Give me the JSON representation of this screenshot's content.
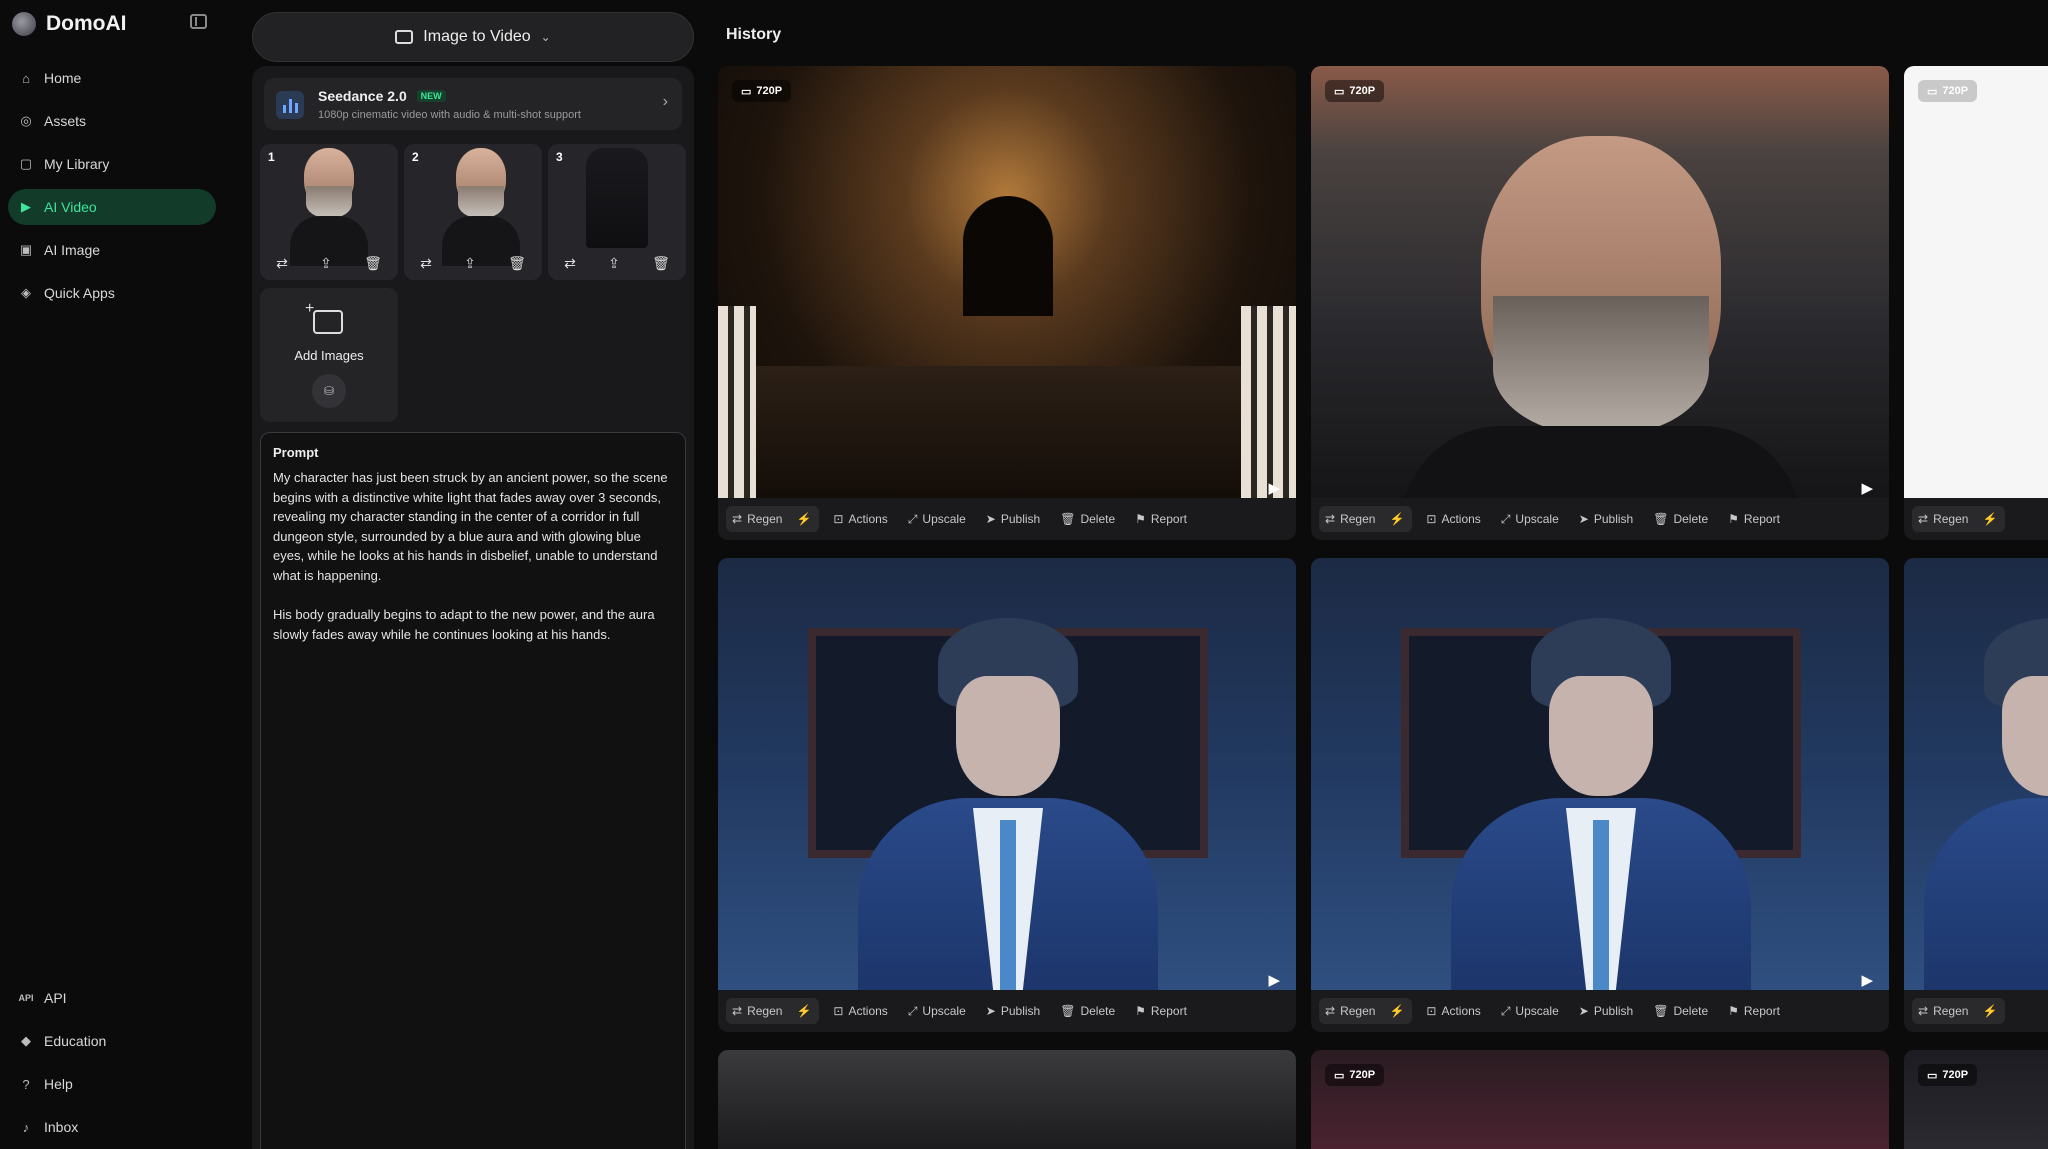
{
  "brand": {
    "name": "DomoAI"
  },
  "nav": {
    "main": [
      {
        "label": "Home",
        "icon": "home-icon",
        "glyph": "⌂"
      },
      {
        "label": "Assets",
        "icon": "assets-icon",
        "glyph": "◎"
      },
      {
        "label": "My Library",
        "icon": "library-icon",
        "glyph": "▢"
      },
      {
        "label": "AI Video",
        "icon": "video-icon",
        "glyph": "▶",
        "active": true
      },
      {
        "label": "AI Image",
        "icon": "image-icon",
        "glyph": "▣"
      },
      {
        "label": "Quick Apps",
        "icon": "apps-icon",
        "glyph": "◈"
      }
    ],
    "bottom": [
      {
        "label": "API",
        "icon": "api-icon",
        "glyph": "API"
      },
      {
        "label": "Education",
        "icon": "education-icon",
        "glyph": "◆"
      },
      {
        "label": "Help",
        "icon": "help-icon",
        "glyph": "?"
      },
      {
        "label": "Inbox",
        "icon": "bell-icon",
        "glyph": "♪"
      }
    ]
  },
  "generator": {
    "mode_label": "Image to Video",
    "model": {
      "name": "Seedance 2.0",
      "badge": "NEW",
      "description": "1080p cinematic video with audio & multi-shot support"
    },
    "references": [
      {
        "number": "1"
      },
      {
        "number": "2"
      },
      {
        "number": "3"
      }
    ],
    "add_images_label": "Add Images",
    "prompt": {
      "label": "Prompt",
      "text": "My character has just been struck by an ancient power, so the scene begins with a distinctive white light that fades away over 3 seconds, revealing my character standing in the center of a corridor in full dungeon style, surrounded by a blue aura and with glowing blue eyes, while he looks at his hands in disbelief, unable to understand what is happening.\n\nHis body gradually begins to adapt to the new power, and the aura slowly fades away while he continues looking at his hands."
    }
  },
  "history": {
    "title": "History",
    "resolution": "720P",
    "toolbar": {
      "regen": "Regen",
      "actions": "Actions",
      "upscale": "Upscale",
      "publish": "Publish",
      "delete": "Delete",
      "report": "Report"
    }
  },
  "colors": {
    "accent": "#3ee59a",
    "active_bg": "#123b2a"
  }
}
